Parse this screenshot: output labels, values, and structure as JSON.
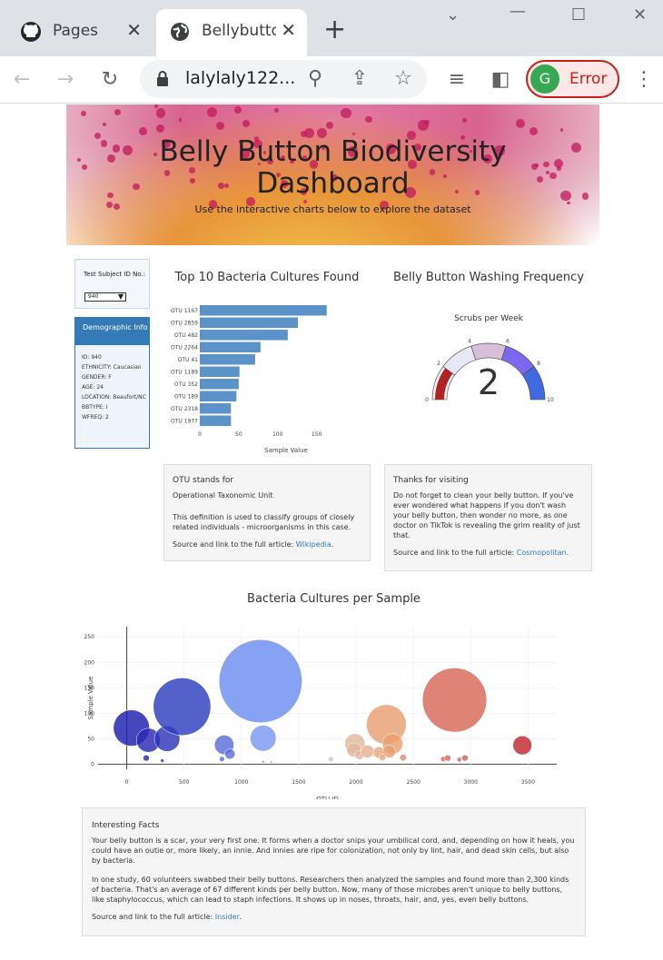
{
  "browser": {
    "tabs": [
      {
        "title": "Pages",
        "icon": "github-icon",
        "active": false
      },
      {
        "title": "Bellybutton",
        "icon": "globe-icon",
        "active": true
      }
    ],
    "url": "lalylaly122...",
    "profile_initial": "G",
    "profile_status": "Error"
  },
  "header": {
    "title_line1": "Belly Button Biodiversity",
    "title_line2": "Dashboard",
    "subtitle": "Use the interactive charts below to explore the dataset"
  },
  "selector": {
    "label": "Test Subject ID No.:",
    "value": "940"
  },
  "demographics": {
    "title": "Demographic Info",
    "rows": [
      "ID: 940",
      "ETHNICITY: Caucasian",
      "GENDER: F",
      "AGE: 24",
      "LOCATION: Beaufort/NC",
      "BBTYPE: I",
      "WFREQ: 2"
    ]
  },
  "bar_panel": {
    "title": "Top 10 Bacteria Cultures Found"
  },
  "gauge_panel": {
    "title": "Belly Button Washing Frequency"
  },
  "otu_card": {
    "title": "OTU stands for",
    "line1": "Operational Taxonomic Unit",
    "body": "This definition is used to classify groups of closely related individuals - microorganisms in this case.",
    "source_prefix": "Source and link to the full article: ",
    "source_link": "Wikipedia",
    "source_suffix": "."
  },
  "thanks_card": {
    "title": "Thanks for visiting",
    "body": "Do not forget to clean your belly button. If you've ever wondered what happens if you don't wash your belly button, then wonder no more, as one doctor on TikTok is revealing the grim reality of just that.",
    "source_prefix": "Source and link to the full article: ",
    "source_link": "Cosmopolitan",
    "source_suffix": "."
  },
  "bubble_panel": {
    "title": "Bacteria Cultures per Sample"
  },
  "facts_card": {
    "title": "Interesting Facts",
    "p1": "Your belly button is a scar, your very first one. It forms when a doctor snips your umbilical cord, and, depending on how it heals, you could have an outie or, more likely, an innie. And innies are ripe for colonization, not only by lint, hair, and dead skin cells, but also by bacteria.",
    "p2": "In one study, 60 volunteers swabbed their belly buttons. Researchers then analyzed the samples and found more than 2,300 kinds of bacteria. That's an average of 67 different kinds per belly button. Now, many of those microbes aren't unique to belly buttons, like staphylococcus, which can lead to staph infections. It shows up in noses, throats, hair, and, yes, even belly buttons.",
    "source_prefix": "Source and link to the full article: ",
    "source_link": "Insider",
    "source_suffix": "."
  },
  "chart_data": [
    {
      "type": "bar",
      "orientation": "horizontal",
      "categories": [
        "OTU 1167",
        "OTU 2859",
        "OTU 482",
        "OTU 2264",
        "OTU 41",
        "OTU 1189",
        "OTU 352",
        "OTU 189",
        "OTU 2318",
        "OTU 1977"
      ],
      "values": [
        163,
        126,
        113,
        78,
        71,
        51,
        50,
        47,
        40,
        40
      ],
      "xlabel": "Sample Value",
      "xlim": [
        0,
        175
      ],
      "xticks": [
        0,
        50,
        100,
        150
      ],
      "color": "#5b93c8"
    },
    {
      "type": "gauge",
      "title": "Scrubs per Week",
      "value": 2,
      "range": [
        0,
        10
      ],
      "ticks": [
        0,
        2,
        4,
        6,
        8,
        10
      ],
      "bands": [
        {
          "range": [
            0,
            2
          ],
          "color": "#f0f0f0"
        },
        {
          "range": [
            2,
            4
          ],
          "color": "#e7e7f8"
        },
        {
          "range": [
            4,
            6
          ],
          "color": "#d8bfd8"
        },
        {
          "range": [
            6,
            8
          ],
          "color": "#7b68ee"
        },
        {
          "range": [
            8,
            10
          ],
          "color": "#4169e1"
        }
      ],
      "bar_color": "#b22222"
    },
    {
      "type": "scatter",
      "xlabel": "OTU ID",
      "ylabel": "Sample Value",
      "xlim": [
        -250,
        3750
      ],
      "ylim": [
        -10,
        270
      ],
      "xticks": [
        0,
        500,
        1000,
        1500,
        2000,
        2500,
        3000,
        3500
      ],
      "yticks": [
        0,
        50,
        100,
        150,
        200,
        250
      ],
      "points": [
        {
          "x": 41,
          "y": 71,
          "color": "#1f1fae"
        },
        {
          "x": 189,
          "y": 47,
          "color": "#2a2ab5"
        },
        {
          "x": 352,
          "y": 50,
          "color": "#2d35b8"
        },
        {
          "x": 482,
          "y": 113,
          "color": "#2f3ec0"
        },
        {
          "x": 170,
          "y": 12,
          "color": "#2a2ab5"
        },
        {
          "x": 310,
          "y": 7,
          "color": "#3a3ab8"
        },
        {
          "x": 850,
          "y": 38,
          "color": "#5a6fd8"
        },
        {
          "x": 830,
          "y": 10,
          "color": "#5a6fd8"
        },
        {
          "x": 900,
          "y": 20,
          "color": "#5a6fd8"
        },
        {
          "x": 1167,
          "y": 163,
          "color": "#6d8ef0"
        },
        {
          "x": 1189,
          "y": 51,
          "color": "#7b98f0"
        },
        {
          "x": 1190,
          "y": 5,
          "color": "#7b98f0"
        },
        {
          "x": 1260,
          "y": 4,
          "color": "#7b98f0"
        },
        {
          "x": 1780,
          "y": 10,
          "color": "#c8c8d0"
        },
        {
          "x": 1990,
          "y": 40,
          "color": "#e0b8a0"
        },
        {
          "x": 1980,
          "y": 28,
          "color": "#e0b8a0"
        },
        {
          "x": 2030,
          "y": 18,
          "color": "#e0b8a0"
        },
        {
          "x": 2100,
          "y": 25,
          "color": "#e8b090"
        },
        {
          "x": 2200,
          "y": 23,
          "color": "#e8a880"
        },
        {
          "x": 2230,
          "y": 13,
          "color": "#e8a880"
        },
        {
          "x": 2264,
          "y": 78,
          "color": "#e8a070"
        },
        {
          "x": 2318,
          "y": 40,
          "color": "#e8a070"
        },
        {
          "x": 2290,
          "y": 25,
          "color": "#e8a070"
        },
        {
          "x": 2410,
          "y": 13,
          "color": "#e09070"
        },
        {
          "x": 2760,
          "y": 10,
          "color": "#d86858"
        },
        {
          "x": 2800,
          "y": 12,
          "color": "#d86858"
        },
        {
          "x": 2859,
          "y": 126,
          "color": "#d86858"
        },
        {
          "x": 2900,
          "y": 9,
          "color": "#d86858"
        },
        {
          "x": 2950,
          "y": 12,
          "color": "#d06050"
        },
        {
          "x": 3450,
          "y": 37,
          "color": "#c0282c"
        }
      ]
    }
  ]
}
